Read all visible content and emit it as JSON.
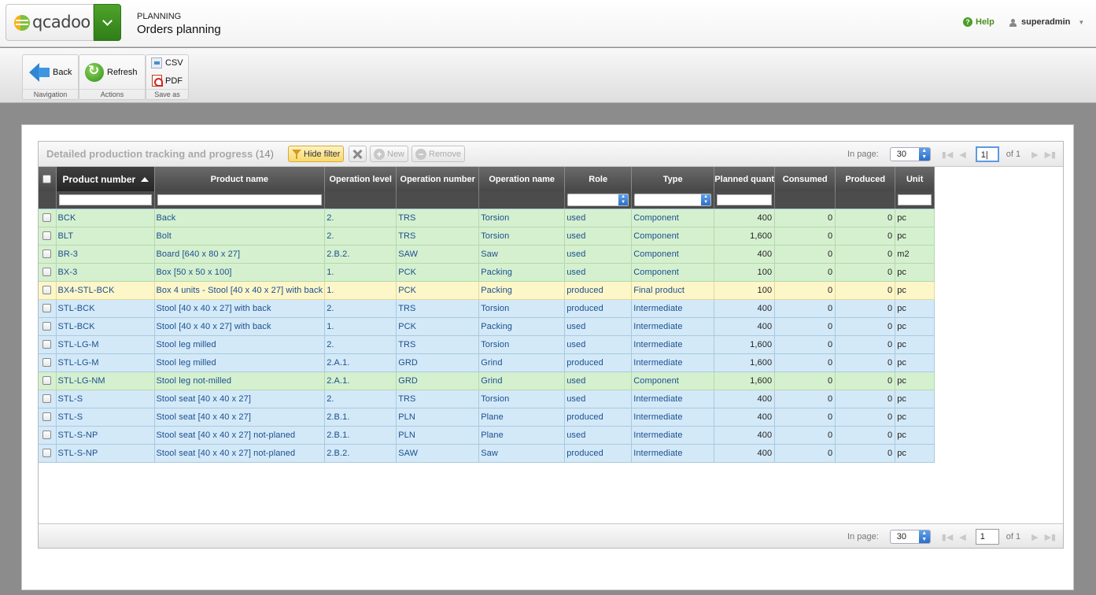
{
  "app": {
    "logo_text": "qcadoo",
    "category": "PLANNING",
    "page_title": "Orders planning",
    "help_label": "Help",
    "user_label": "superadmin"
  },
  "ribbon": {
    "groups": [
      {
        "label": "Navigation",
        "buttons": [
          {
            "label": "Back",
            "icon": "back-arrow-icon"
          }
        ]
      },
      {
        "label": "Actions",
        "buttons": [
          {
            "label": "Refresh",
            "icon": "refresh-icon"
          }
        ]
      },
      {
        "label": "Save as",
        "buttons": [
          {
            "label": "CSV",
            "icon": "csv-icon"
          },
          {
            "label": "PDF",
            "icon": "pdf-icon"
          }
        ]
      }
    ]
  },
  "grid": {
    "title": "Detailed production tracking and progress",
    "count": "(14)",
    "toolbar": {
      "hide_filter": "Hide filter",
      "new": "New",
      "remove": "Remove"
    },
    "pager": {
      "in_page_label": "In page:",
      "page_size": "30",
      "top_page": "1|",
      "bottom_page": "1",
      "of_label": "of 1"
    },
    "columns": [
      "Product number",
      "Product name",
      "Operation level",
      "Operation number",
      "Operation name",
      "Role",
      "Type",
      "Planned quant",
      "Consumed",
      "Produced",
      "Unit"
    ],
    "rows": [
      {
        "c": "green",
        "v": [
          "BCK",
          "Back",
          "2.",
          "TRS",
          "Torsion",
          "used",
          "Component",
          "400",
          "0",
          "0",
          "pc"
        ]
      },
      {
        "c": "green",
        "v": [
          "BLT",
          "Bolt",
          "2.",
          "TRS",
          "Torsion",
          "used",
          "Component",
          "1,600",
          "0",
          "0",
          "pc"
        ]
      },
      {
        "c": "green",
        "v": [
          "BR-3",
          "Board [640 x 80 x 27]",
          "2.B.2.",
          "SAW",
          "Saw",
          "used",
          "Component",
          "400",
          "0",
          "0",
          "m2"
        ]
      },
      {
        "c": "green",
        "v": [
          "BX-3",
          "Box [50 x 50 x 100]",
          "1.",
          "PCK",
          "Packing",
          "used",
          "Component",
          "100",
          "0",
          "0",
          "pc"
        ]
      },
      {
        "c": "yellow",
        "v": [
          "BX4-STL-BCK",
          "Box 4 units - Stool [40 x 40 x 27] with back",
          "1.",
          "PCK",
          "Packing",
          "produced",
          "Final product",
          "100",
          "0",
          "0",
          "pc"
        ]
      },
      {
        "c": "blue",
        "v": [
          "STL-BCK",
          "Stool [40 x 40 x 27] with back",
          "2.",
          "TRS",
          "Torsion",
          "produced",
          "Intermediate",
          "400",
          "0",
          "0",
          "pc"
        ]
      },
      {
        "c": "blue",
        "v": [
          "STL-BCK",
          "Stool [40 x 40 x 27] with back",
          "1.",
          "PCK",
          "Packing",
          "used",
          "Intermediate",
          "400",
          "0",
          "0",
          "pc"
        ]
      },
      {
        "c": "blue",
        "v": [
          "STL-LG-M",
          "Stool leg milled",
          "2.",
          "TRS",
          "Torsion",
          "used",
          "Intermediate",
          "1,600",
          "0",
          "0",
          "pc"
        ]
      },
      {
        "c": "blue",
        "v": [
          "STL-LG-M",
          "Stool leg milled",
          "2.A.1.",
          "GRD",
          "Grind",
          "produced",
          "Intermediate",
          "1,600",
          "0",
          "0",
          "pc"
        ]
      },
      {
        "c": "green",
        "v": [
          "STL-LG-NM",
          "Stool leg not-milled",
          "2.A.1.",
          "GRD",
          "Grind",
          "used",
          "Component",
          "1,600",
          "0",
          "0",
          "pc"
        ]
      },
      {
        "c": "blue",
        "v": [
          "STL-S",
          "Stool seat [40 x 40 x 27]",
          "2.",
          "TRS",
          "Torsion",
          "used",
          "Intermediate",
          "400",
          "0",
          "0",
          "pc"
        ]
      },
      {
        "c": "blue",
        "v": [
          "STL-S",
          "Stool seat [40 x 40 x 27]",
          "2.B.1.",
          "PLN",
          "Plane",
          "produced",
          "Intermediate",
          "400",
          "0",
          "0",
          "pc"
        ]
      },
      {
        "c": "blue",
        "v": [
          "STL-S-NP",
          "Stool seat [40 x 40 x 27] not-planed",
          "2.B.1.",
          "PLN",
          "Plane",
          "used",
          "Intermediate",
          "400",
          "0",
          "0",
          "pc"
        ]
      },
      {
        "c": "blue",
        "v": [
          "STL-S-NP",
          "Stool seat [40 x 40 x 27] not-planed",
          "2.B.2.",
          "SAW",
          "Saw",
          "produced",
          "Intermediate",
          "400",
          "0",
          "0",
          "pc"
        ]
      }
    ]
  },
  "colors": {
    "row_green": "#d5f0cf",
    "row_yellow": "#fdf6c9",
    "row_blue": "#d3e9f8",
    "accent_green": "#3f9a1f",
    "link_blue": "#1b4f8f"
  }
}
